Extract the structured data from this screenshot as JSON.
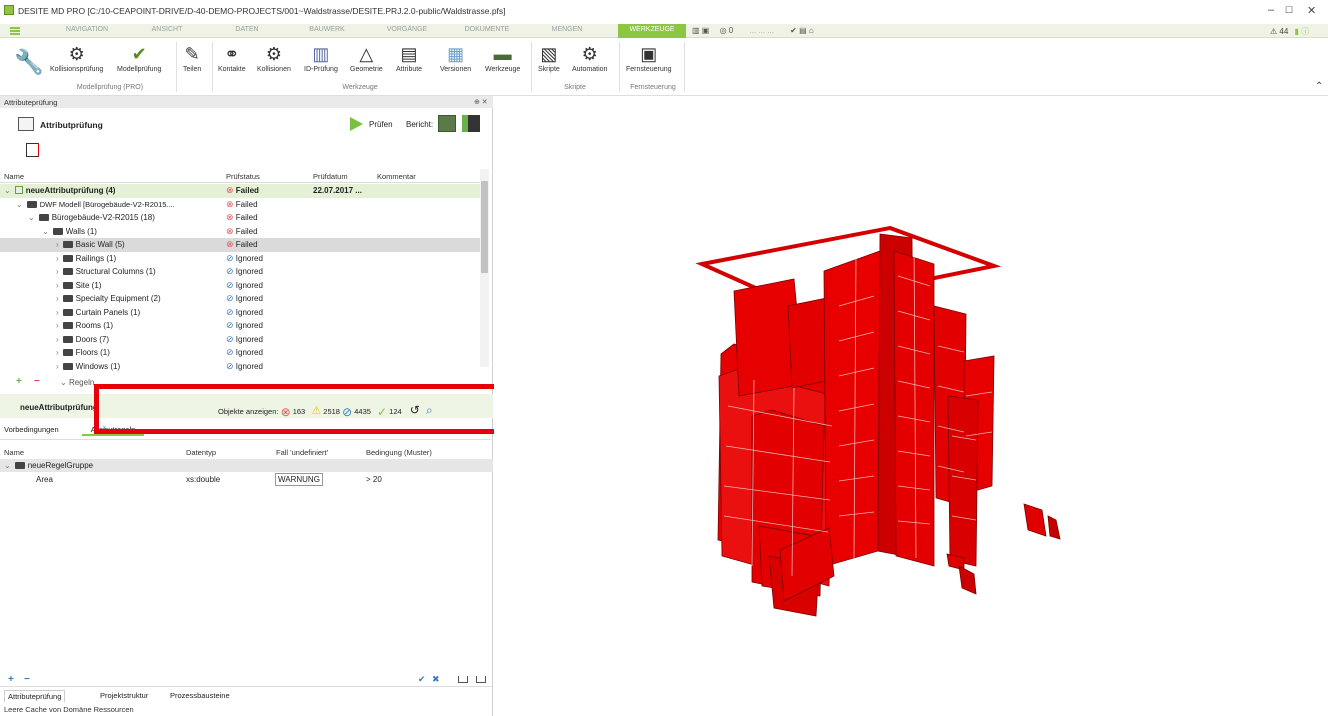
{
  "window": {
    "title": "DESITE MD PRO [C:/10-CEAPOINT-DRIVE/D-40-DEMO-PROJECTS/001~Waldstrasse/DESITE.PRJ.2.0-public/Waldstrasse.pfs]",
    "min": "–",
    "max": "☐",
    "close": "✕"
  },
  "menu": {
    "items": [
      "NAVIGATION",
      "ANSICHT",
      "DATEN",
      "BAUWERK",
      "VORGÄNGE",
      "DOKUMENTE",
      "MENGEN",
      "WERKZEUGE"
    ],
    "active": "WERKZEUGE",
    "count": "0",
    "dots": "... ... ...",
    "warnings": "44"
  },
  "ribbon": {
    "buttons": [
      {
        "label": "Kollisionsprüfung",
        "icon": "collision-check-icon"
      },
      {
        "label": "Modellprüfung",
        "icon": "model-check-icon"
      },
      {
        "label": "Teilen",
        "icon": "share-icon"
      },
      {
        "label": "Kontakte",
        "icon": "contacts-icon"
      },
      {
        "label": "Kollisionen",
        "icon": "collisions-icon"
      },
      {
        "label": "ID-Prüfung",
        "icon": "id-check-icon"
      },
      {
        "label": "Geometrie",
        "icon": "geometry-icon"
      },
      {
        "label": "Attribute",
        "icon": "attribute-icon"
      },
      {
        "label": "Versionen",
        "icon": "versions-icon"
      },
      {
        "label": "Werkzeuge",
        "icon": "tools-icon"
      },
      {
        "label": "Skripte",
        "icon": "scripts-icon"
      },
      {
        "label": "Automation",
        "icon": "automation-icon"
      },
      {
        "label": "Fernsteuerung",
        "icon": "remote-icon"
      }
    ],
    "groups": [
      "Modellprüfung (PRO)",
      "Werkzeuge",
      "Skripte",
      "Fernsteuerung"
    ]
  },
  "pane": {
    "header": "Attributeprüfung",
    "title": "Attributprüfung",
    "run": "Prüfen",
    "report": "Bericht:"
  },
  "tree": {
    "columns": [
      "Name",
      "Prüfstatus",
      "Prüfdatum",
      "Kommentar"
    ],
    "rows": [
      {
        "name": "neueAttributprüfung (4)",
        "status": "Failed",
        "date": "22.07.2017 ...",
        "level": 0,
        "kind": "root"
      },
      {
        "name": "DWF Modell [Bürogebäude-V2-R2015....",
        "status": "Failed",
        "level": 1,
        "kind": "folder"
      },
      {
        "name": "Bürogebäude-V2-R2015 (18)",
        "status": "Failed",
        "level": 2,
        "kind": "folder"
      },
      {
        "name": "Walls (1)",
        "status": "Failed",
        "level": 3,
        "kind": "folder"
      },
      {
        "name": "Basic Wall (5)",
        "status": "Failed",
        "level": 4,
        "kind": "folder"
      },
      {
        "name": "Railings (1)",
        "status": "Ignored",
        "level": 3,
        "kind": "folder"
      },
      {
        "name": "Structural Columns (1)",
        "status": "Ignored",
        "level": 3,
        "kind": "folder"
      },
      {
        "name": "Site (1)",
        "status": "Ignored",
        "level": 3,
        "kind": "folder"
      },
      {
        "name": "Specialty Equipment (2)",
        "status": "Ignored",
        "level": 3,
        "kind": "folder"
      },
      {
        "name": "Curtain Panels (1)",
        "status": "Ignored",
        "level": 3,
        "kind": "folder"
      },
      {
        "name": "Rooms (1)",
        "status": "Ignored",
        "level": 3,
        "kind": "folder"
      },
      {
        "name": "Doors (7)",
        "status": "Ignored",
        "level": 3,
        "kind": "folder"
      },
      {
        "name": "Floors (1)",
        "status": "Ignored",
        "level": 3,
        "kind": "folder"
      },
      {
        "name": "Windows (1)",
        "status": "Ignored",
        "level": 3,
        "kind": "folder"
      }
    ]
  },
  "rules": {
    "label": "Regeln",
    "name": "neueAttributprüfung",
    "show": "Objekte anzeigen:",
    "failed": "163",
    "warning": "2518",
    "ignored": "4435",
    "passed": "124"
  },
  "tabs": {
    "items": [
      "Vorbedingungen",
      "Attributregeln"
    ]
  },
  "ruletable": {
    "columns": [
      "Name",
      "Datentyp",
      "Fall 'undefiniert'",
      "Bedingung (Muster)"
    ],
    "group": "neueRegelGruppe",
    "rows": [
      {
        "name": "Area",
        "type": "xs:double",
        "undef": "WARNUNG",
        "cond": "> 20"
      }
    ]
  },
  "bottomtabs": [
    "Attributeprüfung",
    "Projektstruktur",
    "Prozessbausteine"
  ],
  "status": "Leere Cache von Domäne Ressourcen"
}
